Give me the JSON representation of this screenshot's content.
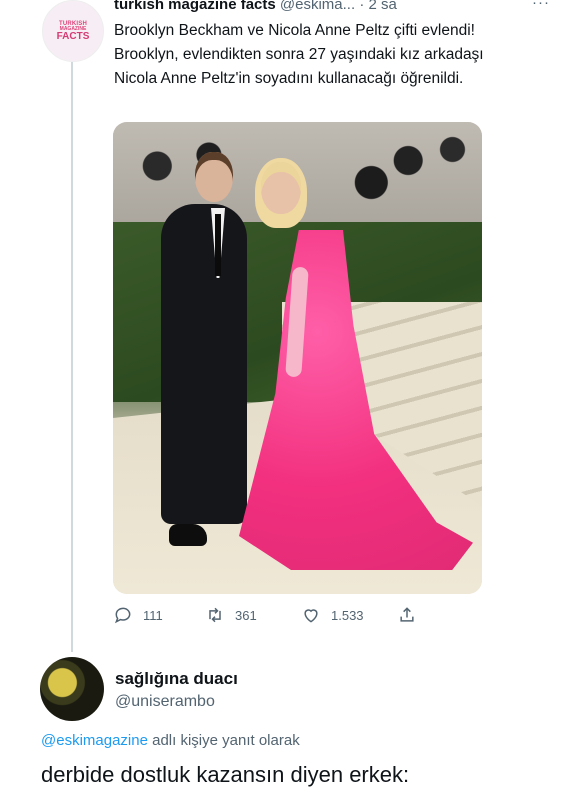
{
  "tweet": {
    "author_name": "turkish magazine facts",
    "handle": "@eskima...",
    "separator": "·",
    "time": "2 sa",
    "more": "···",
    "avatar_text": [
      "TURKISH",
      "MAGAZINE",
      "FACTS"
    ],
    "text": "Brooklyn Beckham ve Nicola Anne Peltz çifti evlendi! Brooklyn, evlendikten sonra 27 yaşındaki kız arkadaşı Nicola Anne Peltz'in soyadını kullanacağı öğrenildi.",
    "actions": {
      "replies": "111",
      "retweets": "361",
      "likes": "1.533"
    }
  },
  "reply": {
    "author_name": "sağlığına duacı",
    "handle": "@uniserambo",
    "replying_to_mention": "@eskimagazine",
    "replying_to_suffix": " adlı kişiye yanıt olarak",
    "text": "derbide dostluk kazansın diyen erkek:"
  },
  "colors": {
    "link": "#1d9bf0",
    "muted": "#536471",
    "text": "#0f1419"
  },
  "icons": {
    "reply": "reply-icon",
    "retweet": "retweet-icon",
    "like": "heart-icon",
    "share": "share-icon"
  }
}
